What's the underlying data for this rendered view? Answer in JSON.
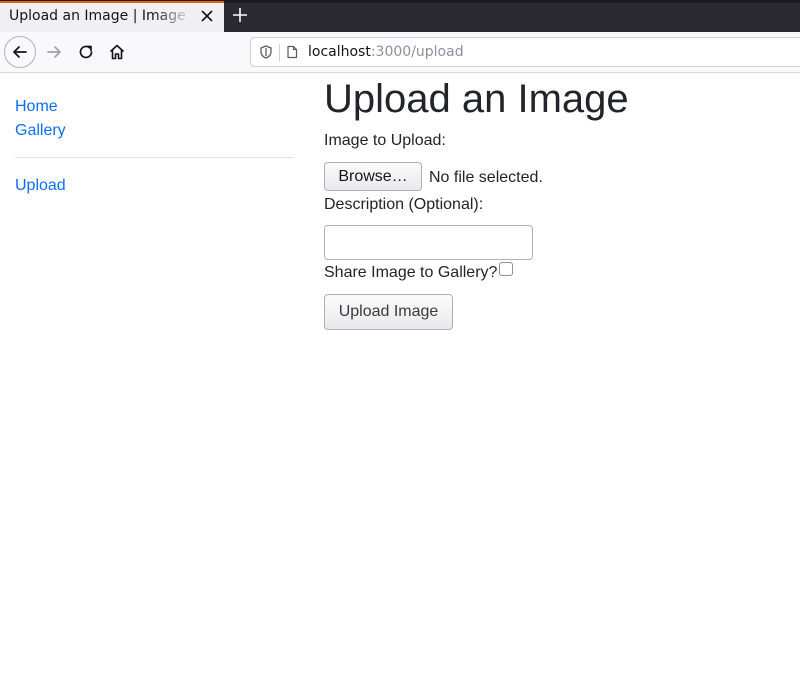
{
  "browser": {
    "tab_title": "Upload an Image | Image Gallery",
    "url_host": "localhost",
    "url_rest": ":3000/upload"
  },
  "sidebar": {
    "links": [
      {
        "label": "Home"
      },
      {
        "label": "Gallery"
      },
      {
        "label": "Upload"
      }
    ]
  },
  "form": {
    "heading": "Upload an Image",
    "image_label": "Image to Upload:",
    "browse_label": "Browse…",
    "file_status": "No file selected.",
    "description_label": "Description (Optional):",
    "description_value": "",
    "share_label": "Share Image to Gallery?",
    "share_checked": false,
    "submit_label": "Upload Image"
  },
  "colors": {
    "link": "#0d6efd",
    "tab_accent": "#e66000",
    "tabstrip_bg": "#2b2a33"
  }
}
